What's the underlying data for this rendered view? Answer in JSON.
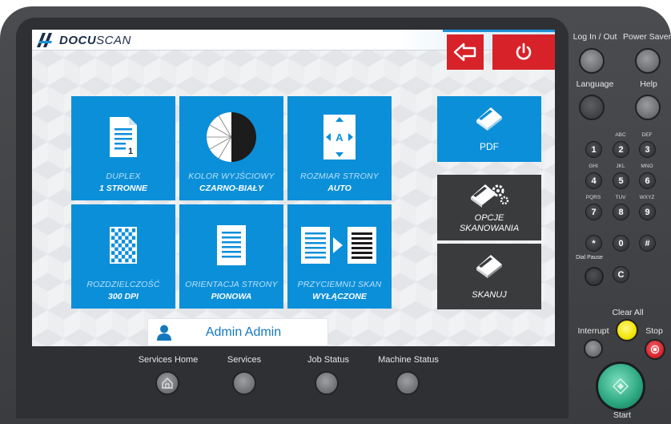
{
  "app": {
    "brand_bold": "DOCU",
    "brand_light": "SCAN"
  },
  "tiles": [
    {
      "label": "DUPLEX",
      "value": "1 STRONNE",
      "icon": "duplex-page-icon"
    },
    {
      "label": "KOLOR WYJŚCIOWY",
      "value": "CZARNO-BIAŁY",
      "icon": "color-half-circle-icon"
    },
    {
      "label": "ROZMIAR STRONY",
      "value": "AUTO",
      "icon": "page-size-auto-icon"
    },
    {
      "label": "ROZDZIELCZOŚĆ",
      "value": "300 DPI",
      "icon": "resolution-checker-icon"
    },
    {
      "label": "ORIENTACJA STRONY",
      "value": "PIONOWA",
      "icon": "portrait-page-icon"
    },
    {
      "label": "PRZYCIEMNIJ SKAN",
      "value": "WYŁĄCZONE",
      "icon": "darken-scan-icon"
    }
  ],
  "side_buttons": {
    "pdf": "PDF",
    "options_line1": "OPCJE",
    "options_line2": "SKANOWANIA",
    "scan": "SKANUJ"
  },
  "user": {
    "name": "Admin Admin"
  },
  "hardware_bottom": {
    "services_home": "Services Home",
    "services": "Services",
    "job_status": "Job Status",
    "machine_status": "Machine Status"
  },
  "panel": {
    "login": "Log In / Out",
    "power_saver": "Power Saver",
    "language": "Language",
    "help": "Help",
    "dial_pause": "Dial Pause",
    "clear_all": "Clear All",
    "interrupt": "Interrupt",
    "stop": "Stop",
    "start": "Start",
    "keys": [
      {
        "digit": "1",
        "sub": ""
      },
      {
        "digit": "2",
        "sub": "ABC"
      },
      {
        "digit": "3",
        "sub": "DEF"
      },
      {
        "digit": "4",
        "sub": "GHI"
      },
      {
        "digit": "5",
        "sub": "JKL"
      },
      {
        "digit": "6",
        "sub": "MNO"
      },
      {
        "digit": "7",
        "sub": "PQRS"
      },
      {
        "digit": "8",
        "sub": "TUV"
      },
      {
        "digit": "9",
        "sub": "WXYZ"
      },
      {
        "digit": "*",
        "sub": ""
      },
      {
        "digit": "0",
        "sub": ""
      },
      {
        "digit": "#",
        "sub": ""
      },
      {
        "digit": "C",
        "sub": ""
      }
    ]
  },
  "colors": {
    "tile_blue": "#0c8fd9",
    "dark_tile": "#3a3b3d",
    "alert_red": "#d7222a",
    "clear_all_yellow": "#f2e500",
    "stop_red": "#d7222a",
    "start_green": "#2aa57e"
  }
}
